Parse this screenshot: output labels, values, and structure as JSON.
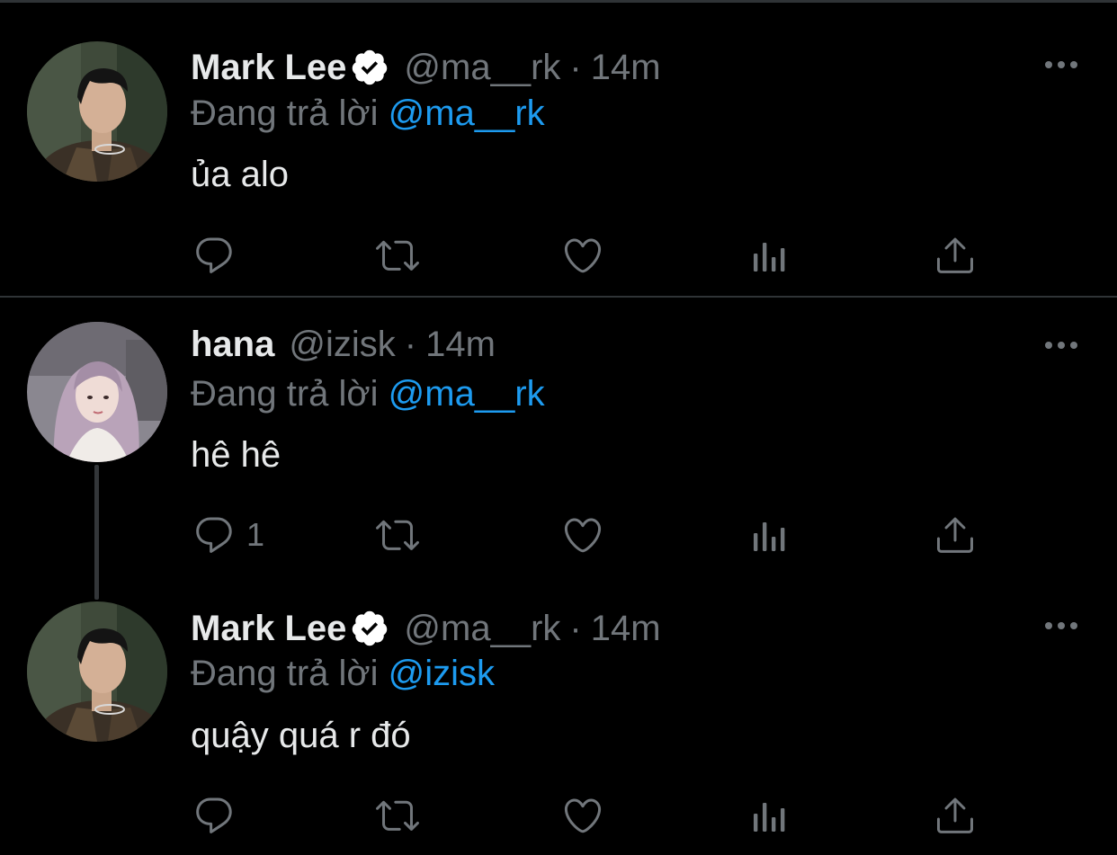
{
  "tweets": [
    {
      "author_name": "Mark Lee",
      "verified": true,
      "handle": "@ma__rk",
      "separator": "·",
      "time": "14m",
      "reply_prefix": "Đang trả lời",
      "reply_mention": "@ma__rk",
      "text": "ủa alo",
      "reply_count": "",
      "avatar": "mark-lee-avatar"
    },
    {
      "author_name": "hana",
      "verified": false,
      "handle": "@izisk",
      "separator": "·",
      "time": "14m",
      "reply_prefix": "Đang trả lời",
      "reply_mention": "@ma__rk",
      "text": "hê hê",
      "reply_count": "1",
      "avatar": "hana-avatar"
    },
    {
      "author_name": "Mark Lee",
      "verified": true,
      "handle": "@ma__rk",
      "separator": "·",
      "time": "14m",
      "reply_prefix": "Đang trả lời",
      "reply_mention": "@izisk",
      "text": "quậy quá r đó",
      "reply_count": "",
      "avatar": "mark-lee-avatar"
    }
  ],
  "colors": {
    "background": "#000000",
    "primary_text": "#e7e9ea",
    "secondary_text": "#71767b",
    "mention": "#1d9bf0",
    "divider": "#2f3336"
  },
  "icons": [
    "reply-icon",
    "retweet-icon",
    "like-icon",
    "analytics-icon",
    "share-icon",
    "more-icon",
    "verified-badge-icon"
  ]
}
